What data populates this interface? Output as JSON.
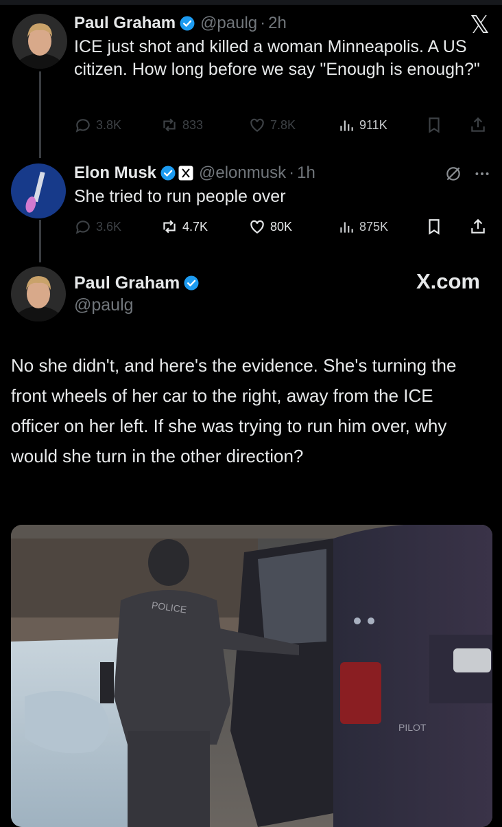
{
  "close_glyph": "𝕏",
  "tweets": [
    {
      "name": "Paul Graham",
      "handle": "@paulg",
      "time": "2h",
      "text": "ICE just shot and killed a woman Minneapolis. A US citizen. How long before we say \"Enough is enough?\"",
      "replies": "3.8K",
      "reposts": "833",
      "likes": "7.8K",
      "views": "911K"
    },
    {
      "name": "Elon Musk",
      "handle": "@elonmusk",
      "time": "1h",
      "text": "She tried to run people over",
      "replies": "3.6K",
      "reposts": "4.7K",
      "likes": "80K",
      "views": "875K"
    }
  ],
  "quoted": {
    "name": "Paul Graham",
    "handle": "@paulg",
    "brand": "X.com",
    "text": "No she didn't, and here's the evidence. She's turning the front wheels of her car to the right, away from the ICE officer on her left. If she was trying to run him over, why would she turn in the other direction?"
  },
  "media_labels": {
    "police_text": "POLICE",
    "pilot_text": "PILOT"
  },
  "colors": {
    "background": "#000000",
    "verified": "#1d9bf0",
    "muted": "#71767b"
  }
}
